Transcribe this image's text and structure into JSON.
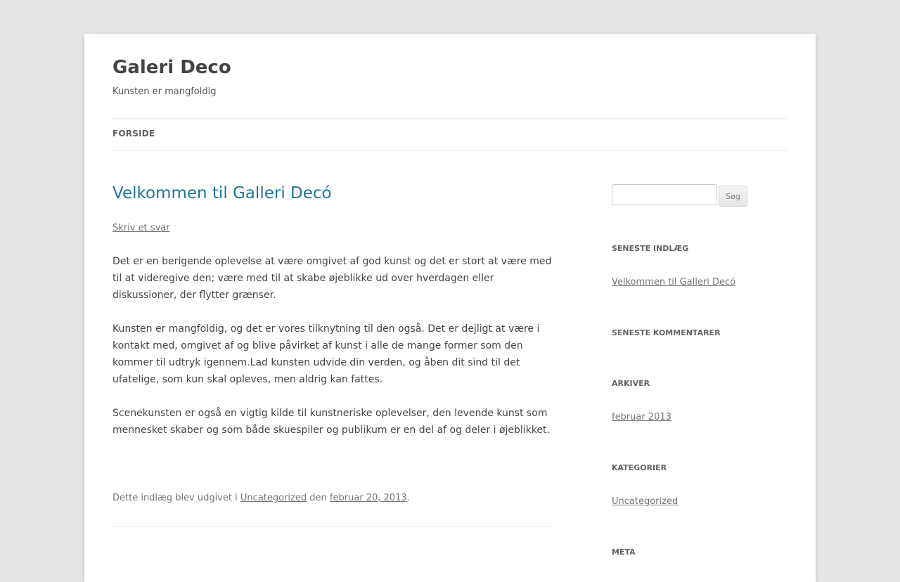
{
  "site": {
    "title": "Galeri Deco",
    "description": "Kunsten er mangfoldig"
  },
  "nav": {
    "items": [
      {
        "label": "Forside"
      }
    ]
  },
  "post": {
    "title": "Velkommen til Galleri Decó",
    "reply_label": "Skriv et svar",
    "paragraphs": [
      "Det er en berigende oplevelse at være omgivet af god kunst og det er stort at være med til at videregive den; være med til at skabe øjeblikke ud over hverdagen eller diskussioner, der flytter grænser.",
      "Kunsten er mangfoldig, og det er vores tilknytning til den også. Det er dejligt at være i kontakt med, omgivet af og blive påvirket af kunst i alle de mange former som den kommer til udtryk igennem.Lad kunsten udvide din verden, og åben dit sind til det ufatelige, som kun skal opleves, men aldrig kan fattes.",
      "Scenekunsten er også en vigtig kilde til kunstneriske oplevelser, den levende kunst som mennesket skaber og som både skuespiler og publikum er en del af og deler i øjeblikket."
    ],
    "meta": {
      "prefix": "Dette indlæg blev udgivet i",
      "category": "Uncategorized",
      "middle": "den",
      "date": "februar 20, 2013",
      "suffix": "."
    }
  },
  "sidebar": {
    "search": {
      "placeholder": "",
      "button_label": "Søg"
    },
    "widgets": {
      "recent_posts": {
        "title": "Seneste indlæg",
        "items": [
          "Velkommen til Galleri Decó"
        ]
      },
      "recent_comments": {
        "title": "Seneste kommentarer"
      },
      "archives": {
        "title": "Arkiver",
        "items": [
          "februar 2013"
        ]
      },
      "categories": {
        "title": "Kategorier",
        "items": [
          "Uncategorized"
        ]
      },
      "meta": {
        "title": "Meta"
      }
    }
  },
  "colors": {
    "background": "#e6e6e6",
    "page": "#ffffff",
    "link_accent": "#21759b",
    "text": "#444444",
    "muted": "#757575"
  }
}
